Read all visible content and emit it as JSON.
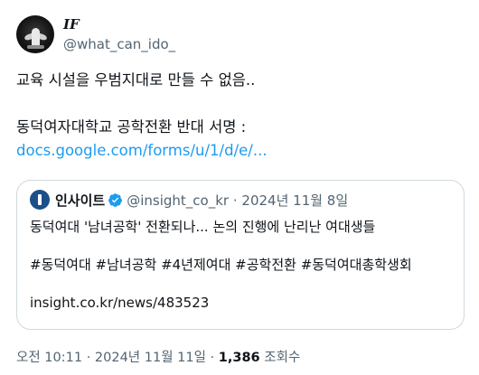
{
  "author": {
    "display_name": "IF",
    "handle": "@what_can_ido_"
  },
  "tweet": {
    "line1": "교육 시설을 우범지대로 만들 수 없음..",
    "line2": "동덕여자대학교 공학전환 반대 서명 :",
    "link": "docs.google.com/forms/u/1/d/e/..."
  },
  "quote": {
    "name": "인사이트",
    "handle": "@insight_co_kr",
    "separator": "·",
    "date": "2024년 11월 8일",
    "headline": "동덕여대 '남녀공학' 전환되나... 논의 진행에 난리난 여대생들",
    "hashtags": "#동덕여대 #남녀공학 #4년제여대 #공학전환 #동덕여대총학생회",
    "url": "insight.co.kr/news/483523"
  },
  "meta": {
    "time": "오전 10:11",
    "sep1": "·",
    "date": "2024년 11월 11일",
    "sep2": "·",
    "views_count": "1,386",
    "views_label": "조회수"
  },
  "colors": {
    "link": "#1d9bf0",
    "secondary_text": "#536471",
    "verified_badge": "#1d9bf0",
    "border": "#cfd9de"
  },
  "icons": {
    "verified": "verified-badge-icon"
  }
}
